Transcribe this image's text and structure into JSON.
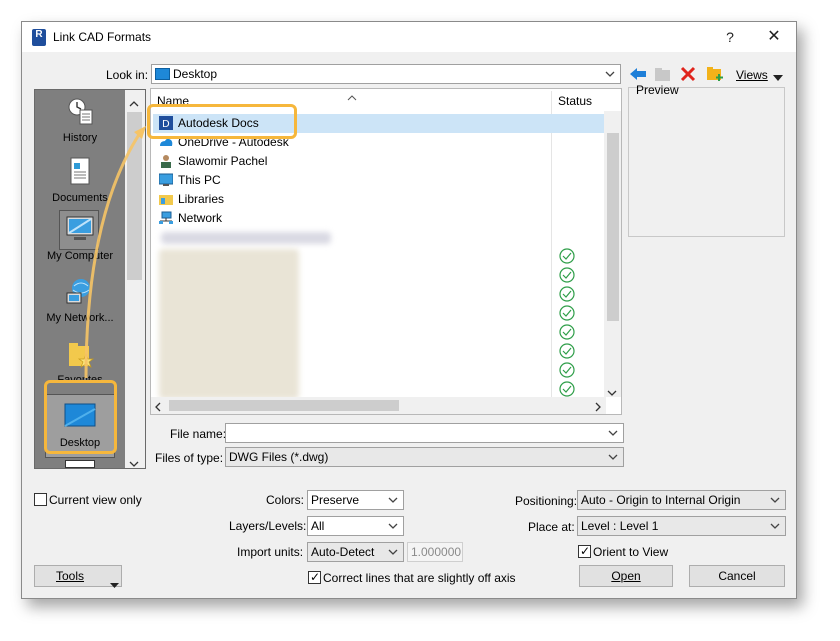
{
  "window": {
    "title": "Link CAD Formats",
    "app_icon": "R",
    "help_label": "?",
    "close_label": "✕"
  },
  "lookin": {
    "label": "Look in:",
    "value": "Desktop"
  },
  "toolbar": {
    "views_label": "Views"
  },
  "places": [
    {
      "label": "History",
      "icon": "history-icon"
    },
    {
      "label": "Documents",
      "icon": "documents-icon"
    },
    {
      "label": "My Computer",
      "icon": "computer-icon"
    },
    {
      "label": "My Network...",
      "icon": "network-places-icon"
    },
    {
      "label": "Favorites",
      "icon": "favorites-icon"
    },
    {
      "label": "Desktop",
      "icon": "desktop-icon"
    }
  ],
  "filelist": {
    "col_name": "Name",
    "col_status": "Status",
    "items": [
      {
        "name": "Autodesk Docs",
        "icon": "autodesk-docs-icon"
      },
      {
        "name": "OneDrive - Autodesk",
        "icon": "onedrive-icon"
      },
      {
        "name": "Slawomir Pachel",
        "icon": "user-icon"
      },
      {
        "name": "This PC",
        "icon": "pc-icon"
      },
      {
        "name": "Libraries",
        "icon": "libraries-icon"
      },
      {
        "name": "Network",
        "icon": "network-icon"
      }
    ]
  },
  "preview": {
    "label": "Preview"
  },
  "filename": {
    "label": "File name:",
    "value": ""
  },
  "filetype": {
    "label": "Files of type:",
    "value": "DWG Files  (*.dwg)"
  },
  "options": {
    "current_view_only": "Current view only",
    "colors_label": "Colors:",
    "colors_value": "Preserve",
    "layers_label": "Layers/Levels:",
    "layers_value": "All",
    "units_label": "Import units:",
    "units_value": "Auto-Detect",
    "scale_value": "1.000000",
    "correct_lines": "Correct lines that are slightly off axis",
    "positioning_label": "Positioning:",
    "positioning_value": "Auto - Origin to Internal Origin",
    "place_at_label": "Place at:",
    "place_at_value": "Level : Level 1",
    "orient_label": "Orient to View"
  },
  "buttons": {
    "tools": "Tools",
    "open": "Open",
    "cancel": "Cancel"
  },
  "colors": {
    "highlight": "#f6b73c",
    "selection": "#cce4f7",
    "check_green": "#2e9e48"
  }
}
